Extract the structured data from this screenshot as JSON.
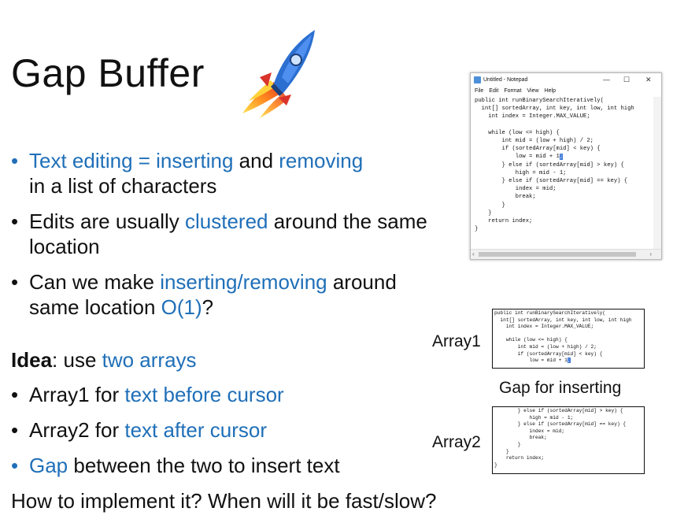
{
  "title": "Gap Buffer",
  "bullets": [
    {
      "segments": [
        {
          "t": "Text editing = inserting",
          "blue": true
        },
        {
          "t": " and ",
          "blue": false
        },
        {
          "t": "removing",
          "blue": true
        }
      ],
      "line2": [
        {
          "t": "in a list of characters",
          "blue": false
        }
      ]
    },
    {
      "segments": [
        {
          "t": "Edits are usually ",
          "blue": false
        },
        {
          "t": "clustered",
          "blue": true
        },
        {
          "t": " around the same",
          "blue": false
        }
      ],
      "line2": [
        {
          "t": "location",
          "blue": false
        }
      ]
    },
    {
      "segments": [
        {
          "t": "Can we make ",
          "blue": false
        },
        {
          "t": "inserting/removing",
          "blue": true
        },
        {
          "t": " around",
          "blue": false
        }
      ],
      "line2": [
        {
          "t": "same location ",
          "blue": false
        },
        {
          "t": "O(1)",
          "blue": true
        },
        {
          "t": "?",
          "blue": false
        }
      ]
    }
  ],
  "idea": {
    "bold": "Idea",
    "rest": ": use ",
    "blue": "two arrays"
  },
  "idea_bullets": [
    [
      {
        "t": "Array1 for ",
        "blue": false
      },
      {
        "t": "text before cursor",
        "blue": true
      }
    ],
    [
      {
        "t": "Array2 for ",
        "blue": false
      },
      {
        "t": "text after cursor",
        "blue": true
      }
    ],
    [
      {
        "t": "Gap",
        "blue": true
      },
      {
        "t": " between the two to insert text",
        "blue": false
      }
    ]
  ],
  "question": "How to implement it?  When will it be fast/slow?",
  "notepad": {
    "title": "Untitled - Notepad",
    "menu": [
      "File",
      "Edit",
      "Format",
      "View",
      "Help"
    ],
    "controls": [
      "—",
      "☐",
      "✕"
    ],
    "code_before": "public int runBinarySearchIteratively(\n  int[] sortedArray, int key, int low, int high\n    int index = Integer.MAX_VALUE;\n\n    while (low <= high) {\n        int mid = (low + high) / 2;\n        if (sortedArray[mid] < key) {\n            low = mid + 1",
    "cursor_char": ";",
    "code_after": "\n        } else if (sortedArray[mid] > key) {\n            high = mid - 1;\n        } else if (sortedArray[mid] == key) {\n            index = mid;\n            break;\n        }\n    }\n    return index;\n}"
  },
  "array1": {
    "label": "Array1",
    "code_before": "public int runBinarySearchIteratively(\n  int[] sortedArray, int key, int low, int high\n    int index = Integer.MAX_VALUE;\n\n    while (low <= high) {\n        int mid = (low + high) / 2;\n        if (sortedArray[mid] < key) {\n            low = mid + 1",
    "cursor_char": ";"
  },
  "gap_label": "Gap for inserting",
  "array2": {
    "label": "Array2",
    "code": "        } else if (sortedArray[mid] > key) {\n            high = mid - 1;\n        } else if (sortedArray[mid] == key) {\n            index = mid;\n            break;\n        }\n    }\n    return index;\n}"
  },
  "colors": {
    "accent": "#1f6fb8",
    "text": "#111111"
  },
  "icons": [
    "rocket-icon",
    "notepad-app-icon"
  ]
}
